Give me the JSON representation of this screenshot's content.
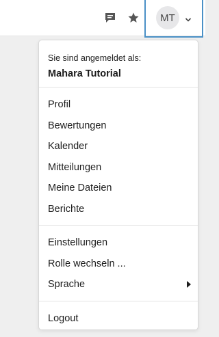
{
  "topbar": {
    "messages_icon": "chat-bubble",
    "favorites_icon": "star",
    "user_initials": "MT",
    "dropdown_icon": "chevron-down"
  },
  "menu": {
    "signed_in_label": "Sie sind angemeldet als:",
    "user_name": "Mahara Tutorial",
    "group1": [
      "Profil",
      "Bewertungen",
      "Kalender",
      "Mitteilungen",
      "Meine Dateien",
      "Berichte"
    ],
    "group2": [
      "Einstellungen",
      "Rolle wechseln ...",
      "Sprache"
    ],
    "group3": [
      "Logout"
    ]
  },
  "colors": {
    "focus_outline": "#4a90c6",
    "icon_gray": "#555555",
    "avatar_bg": "#e7e7e9"
  }
}
